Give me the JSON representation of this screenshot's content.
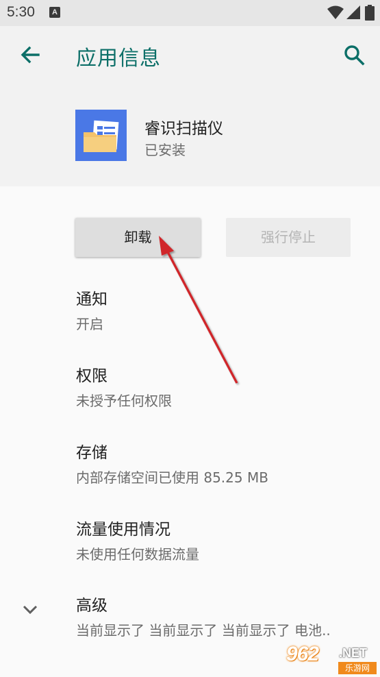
{
  "status_bar": {
    "time": "5:30",
    "notification_icon": "a-notification-icon",
    "icons": [
      "wifi-icon",
      "signal-icon",
      "battery-icon"
    ]
  },
  "app_bar": {
    "back_icon": "arrow-back-icon",
    "title": "应用信息",
    "search_icon": "search-icon"
  },
  "app": {
    "name": "睿识扫描仪",
    "status": "已安装",
    "icon": "folder-document-icon",
    "icon_bg": "#4a78e6"
  },
  "actions": {
    "uninstall": "卸载",
    "force_stop": "强行停止"
  },
  "settings": [
    {
      "title": "通知",
      "subtitle": "开启"
    },
    {
      "title": "权限",
      "subtitle": "未授予任何权限"
    },
    {
      "title": "存储",
      "subtitle": "内部存储空间已使用 85.25 MB"
    },
    {
      "title": "流量使用情况",
      "subtitle": "未使用任何数据流量"
    },
    {
      "title": "高级",
      "subtitle": "当前显示了 当前显示了 当前显示了 电池.."
    }
  ],
  "advanced_expand_icon": "chevron-down-icon",
  "watermark": {
    "main": "962",
    "net": ".NET",
    "sub": "乐游网"
  },
  "colors": {
    "accent": "#0c6f68",
    "annotation_arrow": "#d0262b",
    "watermark_orange": "#f08a1c"
  }
}
